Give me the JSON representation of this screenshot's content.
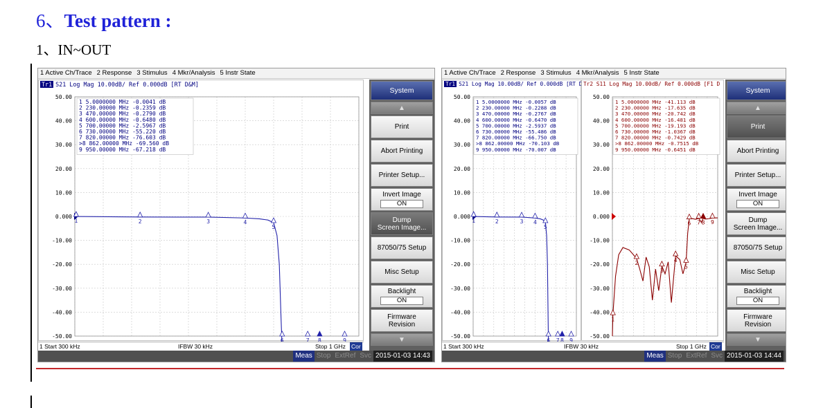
{
  "heading": {
    "number": "6、",
    "text": "Test pattern :"
  },
  "subheading": "1、IN~OUT",
  "menu": [
    "1 Active Ch/Trace",
    "2 Response",
    "3 Stimulus",
    "4 Mkr/Analysis",
    "5 Instr State"
  ],
  "left_screen": {
    "trace_header": {
      "chip": "Tr1",
      "text": "S21 Log Mag 10.00dB/ Ref 0.000dB [RT D&M]"
    },
    "y_ticks": [
      "50.00",
      "40.00",
      "30.00",
      "20.00",
      "10.00",
      "0.000",
      "-10.00",
      "-20.00",
      "-30.00",
      "-40.00",
      "-50.00"
    ],
    "marker_table": [
      "1  5.0000000 MHz -0.0041 dB",
      "2  230.00000 MHz -0.2359 dB",
      "3  470.00000 MHz -0.2790 dB",
      "4  600.00000 MHz -0.6480 dB",
      "5  700.00000 MHz -2.5967 dB",
      "6  730.00000 MHz -55.220 dB",
      "7  820.00000 MHz -76.603 dB",
      ">8  862.00000 MHz -69.560 dB",
      "9  950.00000 MHz -67.218 dB"
    ],
    "status": {
      "start": "1  Start 300 kHz",
      "ifbw": "IFBW 30 kHz",
      "stop": "Stop 1 GHz",
      "cor": "Cor"
    },
    "bottom": {
      "meas": "Meas",
      "stop": "Stop",
      "extref": "ExtRef",
      "svc": "Svc",
      "time": "2015-01-03 14:43"
    }
  },
  "right_screen": {
    "trace1_header": {
      "chip": "Tr1",
      "text": "S21 Log Mag 10.00dB/ Ref 0.000dB [RT D"
    },
    "trace2_header": {
      "text": "Tr2 S11 Log Mag 10.00dB/ Ref 0.000dB [F1 D"
    },
    "y_ticks": [
      "50.00",
      "40.00",
      "30.00",
      "20.00",
      "10.00",
      "0.000",
      "-10.00",
      "-20.00",
      "-30.00",
      "-40.00",
      "-50.00"
    ],
    "marker_table_s21": [
      "1  5.0000000 MHz -0.0057 dB",
      "2  230.00000 MHz -0.2288 dB",
      "3  470.00000 MHz -0.2767 dB",
      "4  600.00000 MHz -0.6470 dB",
      "5  700.00000 MHz -2.5937 dB",
      "6  730.00000 MHz -55.486 dB",
      "7  820.00000 MHz -66.750 dB",
      ">8  862.00000 MHz -70.103 dB",
      "9  950.00000 MHz -70.007 dB"
    ],
    "marker_table_s11": [
      "1  5.0000000 MHz -41.113 dB",
      "2  230.00000 MHz -17.635 dB",
      "3  470.00000 MHz -20.742 dB",
      "4  600.00000 MHz -16.481 dB",
      "5  700.00000 MHz -19.193 dB",
      "6  730.00000 MHz -1.0367 dB",
      "7  820.00000 MHz -0.7429 dB",
      ">8  862.00000 MHz -0.7515 dB",
      "9  950.00000 MHz -0.6451 dB"
    ],
    "status": {
      "start": "1  Start 300 kHz",
      "ifbw": "IFBW 30 kHz",
      "stop": "Stop 1 GHz",
      "cor": "Cor"
    },
    "bottom": {
      "meas": "Meas",
      "stop": "Stop",
      "extref": "ExtRef",
      "svc": "Svc",
      "time": "2015-01-03 14:44"
    }
  },
  "softkeys": {
    "system": "System",
    "print": "Print",
    "abort": "Abort Printing",
    "printer_setup": "Printer Setup...",
    "invert_image": "Invert Image",
    "invert_value": "ON",
    "dump_1": "Dump",
    "dump_2": "Screen Image...",
    "setup_87050": "87050/75 Setup",
    "misc_setup": "Misc Setup",
    "backlight": "Backlight",
    "backlight_value": "ON",
    "firmware_1": "Firmware",
    "firmware_2": "Revision"
  },
  "chart_data": [
    {
      "type": "line",
      "title": "S21 Log Mag 10.00dB/ Ref 0.000dB",
      "xlabel": "",
      "ylabel": "",
      "xlim": [
        0.3,
        1000
      ],
      "ylim": [
        -50,
        50
      ],
      "x_unit": "MHz",
      "y_unit": "dB",
      "series": [
        {
          "name": "S21",
          "color": "#2222aa",
          "x": [
            0.3,
            5,
            230,
            470,
            600,
            650,
            680,
            700,
            712,
            720,
            726,
            730,
            740,
            800,
            862,
            950,
            1000
          ],
          "values": [
            -0.1,
            -0.0041,
            -0.2359,
            -0.279,
            -0.648,
            -1.0,
            -1.5,
            -2.5967,
            -8,
            -20,
            -42,
            -55.22,
            -62,
            -75,
            -69.56,
            -67.218,
            -66
          ]
        }
      ],
      "markers": [
        {
          "id": "1",
          "x": 5,
          "y": -0.0041
        },
        {
          "id": "2",
          "x": 230,
          "y": -0.2359
        },
        {
          "id": "3",
          "x": 470,
          "y": -0.279
        },
        {
          "id": "4",
          "x": 600,
          "y": -0.648
        },
        {
          "id": "5",
          "x": 700,
          "y": -2.5967
        },
        {
          "id": "6",
          "x": 730,
          "y": -55.22
        },
        {
          "id": "7",
          "x": 820,
          "y": -76.603
        },
        {
          "id": "8",
          "x": 862,
          "y": -69.56
        },
        {
          "id": "9",
          "x": 950,
          "y": -67.218
        }
      ]
    },
    {
      "type": "line",
      "title": "S21 Log Mag 10.00dB/ Ref 0.000dB",
      "xlabel": "",
      "ylabel": "",
      "xlim": [
        0.3,
        1000
      ],
      "ylim": [
        -50,
        50
      ],
      "x_unit": "MHz",
      "y_unit": "dB",
      "series": [
        {
          "name": "S21",
          "color": "#2222aa",
          "x": [
            0.3,
            5,
            230,
            470,
            600,
            650,
            680,
            700,
            712,
            720,
            726,
            730,
            740,
            800,
            862,
            950,
            1000
          ],
          "values": [
            -0.1,
            -0.0057,
            -0.2288,
            -0.2767,
            -0.647,
            -1.0,
            -1.5,
            -2.5937,
            -8,
            -20,
            -42,
            -55.486,
            -62,
            -66.75,
            -70.103,
            -70.007,
            -68
          ]
        }
      ],
      "markers": [
        {
          "id": "1",
          "x": 5,
          "y": -0.0057
        },
        {
          "id": "2",
          "x": 230,
          "y": -0.2288
        },
        {
          "id": "3",
          "x": 470,
          "y": -0.2767
        },
        {
          "id": "4",
          "x": 600,
          "y": -0.647
        },
        {
          "id": "5",
          "x": 700,
          "y": -2.5937
        },
        {
          "id": "6",
          "x": 730,
          "y": -55.486
        },
        {
          "id": "7",
          "x": 820,
          "y": -66.75
        },
        {
          "id": "8",
          "x": 862,
          "y": -70.103
        },
        {
          "id": "9",
          "x": 950,
          "y": -70.007
        }
      ]
    },
    {
      "type": "line",
      "title": "S11 Log Mag 10.00dB/ Ref 0.000dB",
      "xlabel": "",
      "ylabel": "",
      "xlim": [
        0.3,
        1000
      ],
      "ylim": [
        -50,
        50
      ],
      "x_unit": "MHz",
      "y_unit": "dB",
      "series": [
        {
          "name": "S11",
          "color": "#8b0000",
          "x": [
            0.3,
            5,
            30,
            60,
            100,
            160,
            200,
            230,
            260,
            290,
            320,
            350,
            380,
            410,
            440,
            470,
            500,
            530,
            560,
            600,
            640,
            670,
            700,
            715,
            730,
            760,
            790,
            820,
            845,
            862,
            880,
            920,
            950,
            1000
          ],
          "values": [
            -50,
            -41.113,
            -25,
            -16,
            -13,
            -14,
            -16,
            -17.635,
            -22,
            -27,
            -17,
            -21,
            -35,
            -22,
            -31,
            -20.742,
            -24,
            -19,
            -36,
            -16.481,
            -18,
            -24,
            -19.193,
            -7,
            -1.0367,
            -0.9,
            -1.2,
            -0.7429,
            -2.5,
            -0.7515,
            -1.1,
            -0.9,
            -0.6451,
            -0.6
          ]
        }
      ],
      "markers": [
        {
          "id": "1",
          "x": 5,
          "y": -41.113
        },
        {
          "id": "2",
          "x": 230,
          "y": -17.635
        },
        {
          "id": "3",
          "x": 470,
          "y": -20.742
        },
        {
          "id": "4",
          "x": 600,
          "y": -16.481
        },
        {
          "id": "5",
          "x": 700,
          "y": -19.193
        },
        {
          "id": "6",
          "x": 730,
          "y": -1.0367
        },
        {
          "id": "7",
          "x": 820,
          "y": -0.7429
        },
        {
          "id": "8",
          "x": 862,
          "y": -0.7515
        },
        {
          "id": "9",
          "x": 950,
          "y": -0.6451
        }
      ]
    }
  ]
}
